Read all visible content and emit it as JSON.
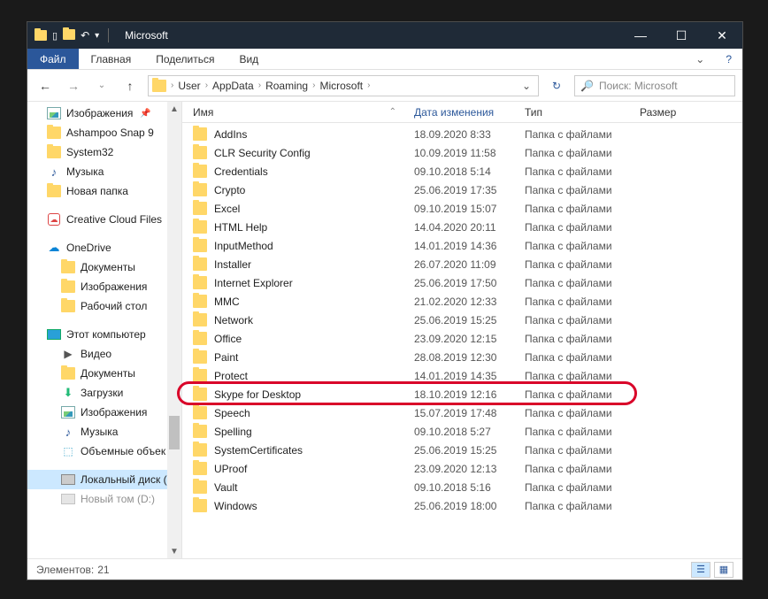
{
  "window": {
    "title": "Microsoft"
  },
  "ribbon": {
    "file": "Файл",
    "tabs": [
      "Главная",
      "Поделиться",
      "Вид"
    ]
  },
  "breadcrumb": [
    "User",
    "AppData",
    "Roaming",
    "Microsoft"
  ],
  "search": {
    "placeholder": "Поиск: Microsoft"
  },
  "columns": {
    "name": "Имя",
    "date": "Дата изменения",
    "type": "Тип",
    "size": "Размер"
  },
  "sidebar": [
    {
      "label": "Изображения",
      "icon": "pic",
      "pinned": true
    },
    {
      "label": "Ashampoo Snap 9",
      "icon": "folder"
    },
    {
      "label": "System32",
      "icon": "folder"
    },
    {
      "label": "Музыка",
      "icon": "music"
    },
    {
      "label": "Новая папка",
      "icon": "folder"
    },
    {
      "gap": true
    },
    {
      "label": "Creative Cloud Files",
      "icon": "cc"
    },
    {
      "gap": true
    },
    {
      "label": "OneDrive",
      "icon": "cloud"
    },
    {
      "label": "Документы",
      "icon": "folder",
      "indent": true
    },
    {
      "label": "Изображения",
      "icon": "folder",
      "indent": true
    },
    {
      "label": "Рабочий стол",
      "icon": "folder",
      "indent": true
    },
    {
      "gap": true
    },
    {
      "label": "Этот компьютер",
      "icon": "pc"
    },
    {
      "label": "Видео",
      "icon": "video",
      "indent": true
    },
    {
      "label": "Документы",
      "icon": "folder",
      "indent": true
    },
    {
      "label": "Загрузки",
      "icon": "dl",
      "indent": true
    },
    {
      "label": "Изображения",
      "icon": "pic",
      "indent": true
    },
    {
      "label": "Музыка",
      "icon": "music",
      "indent": true
    },
    {
      "label": "Объемные объек",
      "icon": "cube",
      "indent": true
    },
    {
      "gap": true
    },
    {
      "label": "Локальный диск (",
      "icon": "hdd",
      "indent": true,
      "selected": true
    },
    {
      "label": "Новый том (D:)",
      "icon": "hdd",
      "indent": true,
      "faded": true
    }
  ],
  "files": [
    {
      "name": "AddIns",
      "date": "18.09.2020 8:33",
      "type": "Папка с файлами"
    },
    {
      "name": "CLR Security Config",
      "date": "10.09.2019 11:58",
      "type": "Папка с файлами"
    },
    {
      "name": "Credentials",
      "date": "09.10.2018 5:14",
      "type": "Папка с файлами"
    },
    {
      "name": "Crypto",
      "date": "25.06.2019 17:35",
      "type": "Папка с файлами"
    },
    {
      "name": "Excel",
      "date": "09.10.2019 15:07",
      "type": "Папка с файлами"
    },
    {
      "name": "HTML Help",
      "date": "14.04.2020 20:11",
      "type": "Папка с файлами"
    },
    {
      "name": "InputMethod",
      "date": "14.01.2019 14:36",
      "type": "Папка с файлами"
    },
    {
      "name": "Installer",
      "date": "26.07.2020 11:09",
      "type": "Папка с файлами"
    },
    {
      "name": "Internet Explorer",
      "date": "25.06.2019 17:50",
      "type": "Папка с файлами"
    },
    {
      "name": "MMC",
      "date": "21.02.2020 12:33",
      "type": "Папка с файлами"
    },
    {
      "name": "Network",
      "date": "25.06.2019 15:25",
      "type": "Папка с файлами"
    },
    {
      "name": "Office",
      "date": "23.09.2020 12:15",
      "type": "Папка с файлами"
    },
    {
      "name": "Paint",
      "date": "28.08.2019 12:30",
      "type": "Папка с файлами"
    },
    {
      "name": "Protect",
      "date": "14.01.2019 14:35",
      "type": "Папка с файлами"
    },
    {
      "name": "Skype for Desktop",
      "date": "18.10.2019 12:16",
      "type": "Папка с файлами",
      "highlighted": true
    },
    {
      "name": "Speech",
      "date": "15.07.2019 17:48",
      "type": "Папка с файлами"
    },
    {
      "name": "Spelling",
      "date": "09.10.2018 5:27",
      "type": "Папка с файлами"
    },
    {
      "name": "SystemCertificates",
      "date": "25.06.2019 15:25",
      "type": "Папка с файлами"
    },
    {
      "name": "UProof",
      "date": "23.09.2020 12:13",
      "type": "Папка с файлами"
    },
    {
      "name": "Vault",
      "date": "09.10.2018 5:16",
      "type": "Папка с файлами"
    },
    {
      "name": "Windows",
      "date": "25.06.2019 18:00",
      "type": "Папка с файлами"
    }
  ],
  "status": {
    "items_label": "Элементов:",
    "count": "21"
  }
}
